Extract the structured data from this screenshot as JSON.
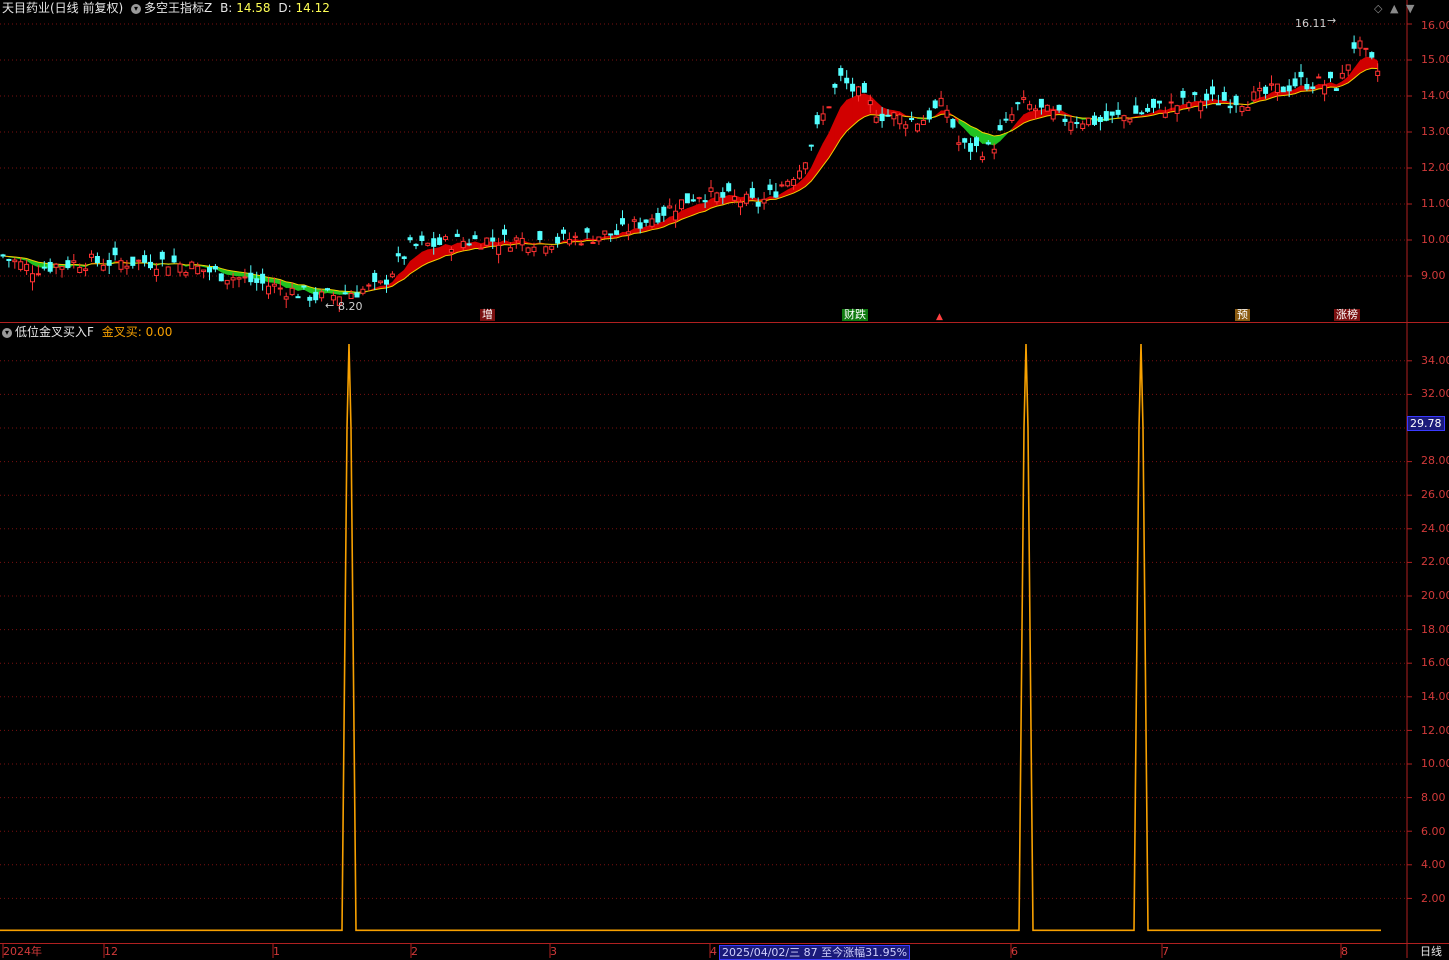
{
  "header": {
    "stock_title": "天目药业(日线 前复权)",
    "indicator_name": "多空王指标Z",
    "b_label": "B:",
    "b_value": "14.58",
    "d_label": "D:",
    "d_value": "14.12"
  },
  "sub_header": {
    "indicator_name": "低位金叉买入F",
    "series_label": "金叉买:",
    "series_value": "0.00"
  },
  "annotations": {
    "high_label": "16.11",
    "low_label": "8.20",
    "signals": [
      "增",
      "财跌",
      "预",
      "涨榜"
    ]
  },
  "price_axis": [
    "16.00",
    "15.00",
    "14.00",
    "13.00",
    "12.00",
    "11.00",
    "10.00",
    "9.00"
  ],
  "indicator_axis": [
    "34.00",
    "32.00",
    "30.00",
    "28.00",
    "26.00",
    "24.00",
    "22.00",
    "20.00",
    "18.00",
    "16.00",
    "14.00",
    "12.00",
    "10.00",
    "8.00",
    "6.00",
    "4.00",
    "2.00"
  ],
  "indicator_current": "29.78",
  "time_axis": [
    "2024年",
    "12",
    "1",
    "2",
    "3",
    "4",
    "6",
    "7",
    "8"
  ],
  "time_highlight": "2025/04/02/三 87 至今涨幅31.95%",
  "period_label": "日线",
  "colors": {
    "up": "#ff3232",
    "down": "#54ffff",
    "band_up": "#d10000",
    "band_down": "#22c322",
    "line": "#f7a000",
    "axis": "#b02020"
  },
  "chart_data": [
    {
      "type": "candlestick",
      "title": "多空王指标Z",
      "ylim": [
        7.5,
        16.5
      ],
      "high_marker": 16.11,
      "low_marker": 8.2
    },
    {
      "type": "line",
      "title": "低位金叉买入F",
      "ylim": [
        0,
        36
      ],
      "series": [
        {
          "name": "金叉买",
          "peaks": [
            35,
            35,
            35
          ],
          "baseline": 0
        }
      ]
    }
  ]
}
